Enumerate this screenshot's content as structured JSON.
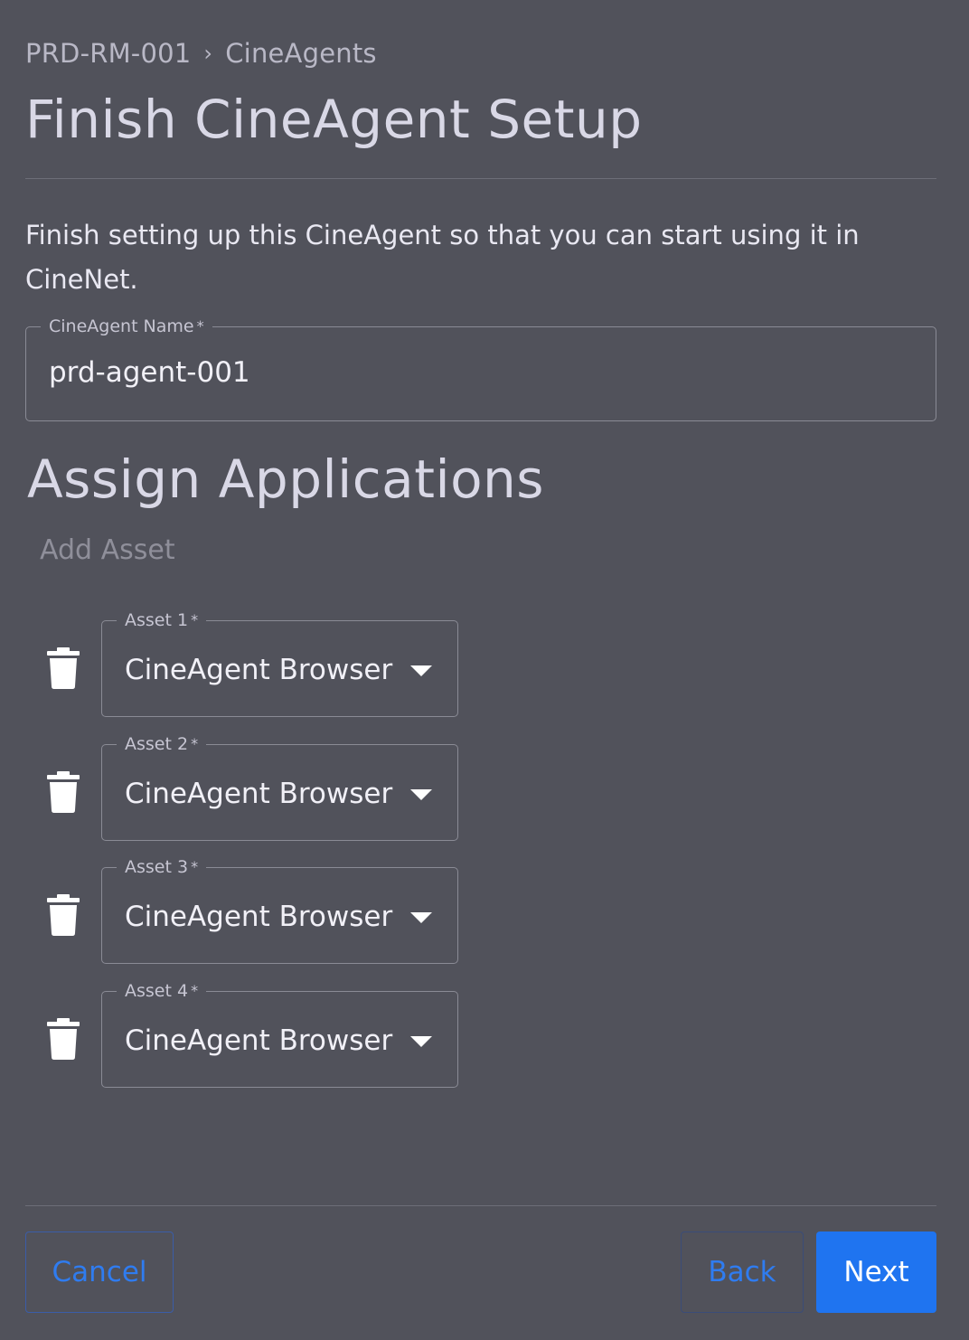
{
  "breadcrumb": {
    "items": [
      "PRD-RM-001",
      "CineAgents"
    ],
    "separator": "›"
  },
  "page_title": "Finish CineAgent Setup",
  "description": "Finish setting up this CineAgent so that you can start using it in CineNet.",
  "name_field": {
    "label": "CineAgent Name",
    "required_mark": "*",
    "value": "prd-agent-001"
  },
  "assign": {
    "title": "Assign Applications",
    "add_asset_label": "Add Asset",
    "assets": [
      {
        "label": "Asset 1",
        "required_mark": "*",
        "value": "CineAgent Browser"
      },
      {
        "label": "Asset 2",
        "required_mark": "*",
        "value": "CineAgent Browser"
      },
      {
        "label": "Asset 3",
        "required_mark": "*",
        "value": "CineAgent Browser"
      },
      {
        "label": "Asset 4",
        "required_mark": "*",
        "value": "CineAgent Browser"
      }
    ]
  },
  "footer": {
    "cancel_label": "Cancel",
    "back_label": "Back",
    "next_label": "Next"
  },
  "icons": {
    "delete": "trash-icon",
    "dropdown": "caret-down-icon"
  },
  "colors": {
    "background": "#51525b",
    "primary": "#1f74f0",
    "link": "#2f7cf0"
  }
}
